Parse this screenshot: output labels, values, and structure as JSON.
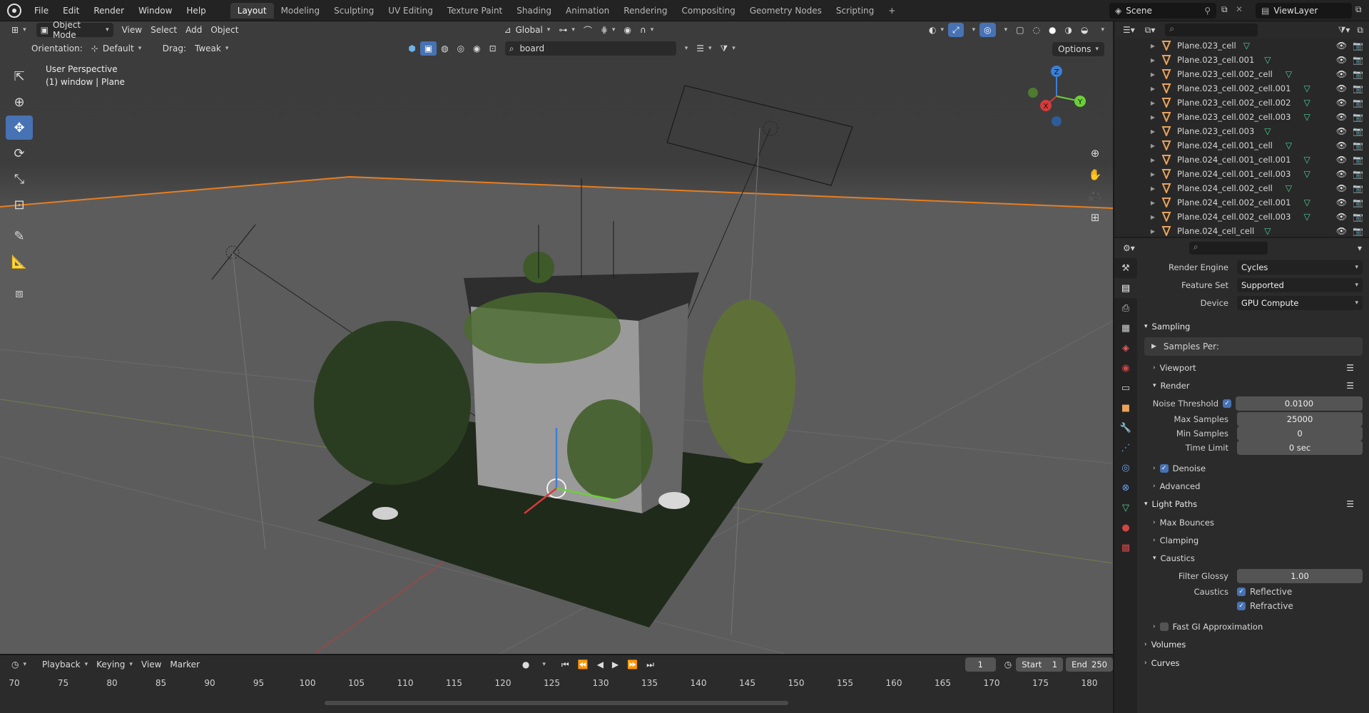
{
  "top_menu": {
    "menus": [
      "File",
      "Edit",
      "Render",
      "Window",
      "Help"
    ],
    "workspaces": [
      "Layout",
      "Modeling",
      "Sculpting",
      "UV Editing",
      "Texture Paint",
      "Shading",
      "Animation",
      "Rendering",
      "Compositing",
      "Geometry Nodes",
      "Scripting"
    ],
    "active_workspace": "Layout",
    "add_workspace": "+",
    "scene": "Scene",
    "view_layer": "ViewLayer"
  },
  "viewport": {
    "mode": "Object Mode",
    "menus": [
      "View",
      "Select",
      "Add",
      "Object"
    ],
    "transform_orientation": "Global",
    "orientation_label": "Orientation:",
    "orientation_value": "Default",
    "drag_label": "Drag:",
    "drag_value": "Tweak",
    "search_value": "board",
    "options_label": "Options",
    "info_line1": "User Perspective",
    "info_line2": "(1) window | Plane",
    "gizmo_axes": {
      "x": "X",
      "y": "Y",
      "z": "Z"
    }
  },
  "outliner": {
    "items": [
      "Plane.023_cell",
      "Plane.023_cell.001",
      "Plane.023_cell.002_cell",
      "Plane.023_cell.002_cell.001",
      "Plane.023_cell.002_cell.002",
      "Plane.023_cell.002_cell.003",
      "Plane.023_cell.003",
      "Plane.024_cell.001_cell",
      "Plane.024_cell.001_cell.001",
      "Plane.024_cell.001_cell.003",
      "Plane.024_cell.002_cell",
      "Plane.024_cell.002_cell.001",
      "Plane.024_cell.002_cell.003",
      "Plane.024_cell_cell"
    ]
  },
  "properties": {
    "render_engine_label": "Render Engine",
    "render_engine": "Cycles",
    "feature_set_label": "Feature Set",
    "feature_set": "Supported",
    "device_label": "Device",
    "device": "GPU Compute",
    "sampling_label": "Sampling",
    "samples_per_label": "Samples Per:",
    "viewport_label": "Viewport",
    "render_label": "Render",
    "noise_threshold_label": "Noise Threshold",
    "noise_threshold": "0.0100",
    "max_samples_label": "Max Samples",
    "max_samples": "25000",
    "min_samples_label": "Min Samples",
    "min_samples": "0",
    "time_limit_label": "Time Limit",
    "time_limit": "0 sec",
    "denoise_label": "Denoise",
    "advanced_label": "Advanced",
    "light_paths_label": "Light Paths",
    "max_bounces_label": "Max Bounces",
    "clamping_label": "Clamping",
    "caustics_label": "Caustics",
    "filter_glossy_label": "Filter Glossy",
    "filter_glossy": "1.00",
    "caustics_row_label": "Caustics",
    "reflective_label": "Reflective",
    "refractive_label": "Refractive",
    "fast_gi_label": "Fast GI Approximation",
    "volumes_label": "Volumes",
    "curves_label": "Curves"
  },
  "timeline": {
    "menus": [
      "Playback",
      "Keying",
      "View",
      "Marker"
    ],
    "current_frame": "1",
    "start_label": "Start",
    "start": "1",
    "end_label": "End",
    "end": "250",
    "ruler": [
      "70",
      "75",
      "80",
      "85",
      "90",
      "95",
      "100",
      "105",
      "110",
      "115",
      "120",
      "125",
      "130",
      "135",
      "140",
      "145",
      "150",
      "155",
      "160",
      "165",
      "170",
      "175",
      "180"
    ]
  },
  "colors": {
    "accent": "#4772b3",
    "mesh_icon": "#4ecf9a",
    "object_icon": "#e8a35a",
    "floor_edge": "#e67e22"
  }
}
